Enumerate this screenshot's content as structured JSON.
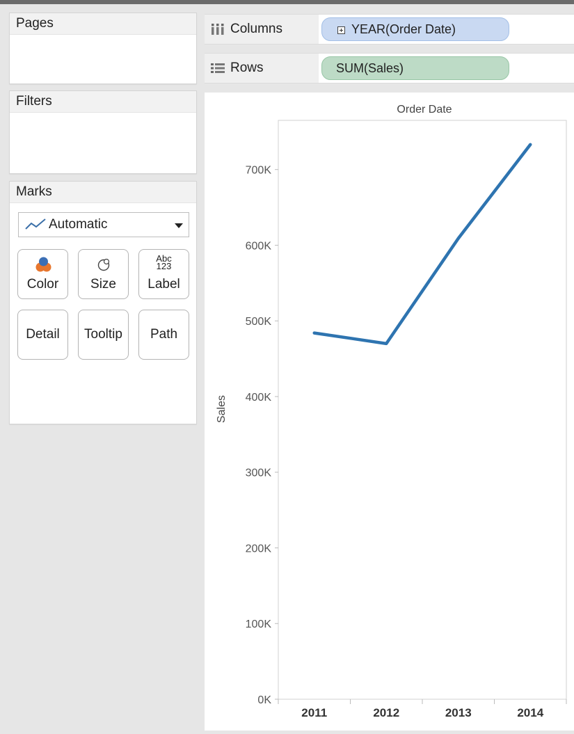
{
  "panels": {
    "pages": {
      "title": "Pages"
    },
    "filters": {
      "title": "Filters"
    },
    "marks": {
      "title": "Marks",
      "mark_type": "Automatic",
      "buttons": [
        "Color",
        "Size",
        "Label",
        "Detail",
        "Tooltip",
        "Path"
      ],
      "label_icon_text": [
        "Abc",
        "123"
      ]
    }
  },
  "shelves": {
    "columns": {
      "label": "Columns",
      "pill": "YEAR(Order Date)",
      "pill_color": "#c9d9f2"
    },
    "rows": {
      "label": "Rows",
      "pill": "SUM(Sales)",
      "pill_color": "#bddbc6"
    }
  },
  "chart_data": {
    "type": "line",
    "title": "Order Date",
    "ylabel": "Sales",
    "xlabel": "",
    "categories": [
      "2011",
      "2012",
      "2013",
      "2014"
    ],
    "series": [
      {
        "values": [
          484000,
          470000,
          609000,
          733000
        ],
        "color": "#2e74b0"
      }
    ],
    "ylim": [
      0,
      765000
    ],
    "yticks": [
      0,
      100000,
      200000,
      300000,
      400000,
      500000,
      600000,
      700000
    ],
    "ytick_labels": [
      "0K",
      "100K",
      "200K",
      "300K",
      "400K",
      "500K",
      "600K",
      "700K"
    ],
    "grid": false,
    "legend": "none"
  }
}
